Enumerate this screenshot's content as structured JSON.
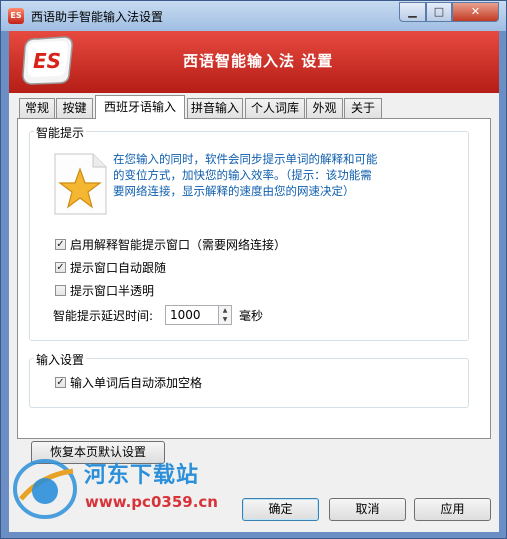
{
  "window": {
    "title": "西语助手智能输入法设置"
  },
  "banner": {
    "logo_text": "ES",
    "title": "西语智能输入法 设置"
  },
  "tabs": [
    {
      "label": "常规"
    },
    {
      "label": "按键"
    },
    {
      "label": "西班牙语输入",
      "active": true
    },
    {
      "label": "拼音输入"
    },
    {
      "label": "个人词库"
    },
    {
      "label": "外观"
    },
    {
      "label": "关于"
    }
  ],
  "smart_hint": {
    "group_label": "智能提示",
    "description_line1": "在您输入的同时，软件会同步提示单词的解释和可能",
    "description_line2": "的变位方式，加快您的输入效率。（提示：该功能需",
    "description_line3": "要网络连接，显示解释的速度由您的网速决定）",
    "options": [
      {
        "label": "启用解释智能提示窗口（需要网络连接）",
        "checked": true
      },
      {
        "label": "提示窗口自动跟随",
        "checked": true
      },
      {
        "label": "提示窗口半透明",
        "checked": false
      }
    ],
    "delay_label": "智能提示延迟时间:",
    "delay_value": "1000",
    "delay_unit": "毫秒"
  },
  "input_settings": {
    "group_label": "输入设置",
    "options": [
      {
        "label": "输入单词后自动添加空格",
        "checked": true
      }
    ]
  },
  "buttons": {
    "restore_defaults": "恢复本页默认设置",
    "ok": "确定",
    "cancel": "取消",
    "apply": "应用"
  },
  "watermark": {
    "title": "河东下载站",
    "url": "www.pc0359.cn"
  },
  "colors": {
    "banner": "#c8271f",
    "hint_text": "#0f5faf",
    "watermark_blue": "#2b8fd9",
    "watermark_red": "#d7343a"
  }
}
